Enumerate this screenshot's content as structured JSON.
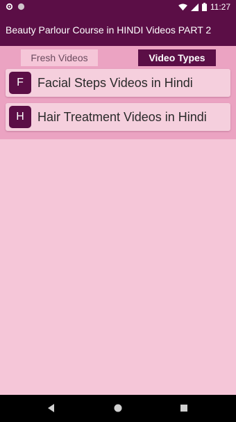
{
  "status_bar": {
    "time": "11:27",
    "icons": [
      "gear-icon",
      "circle-icon",
      "wifi-icon",
      "signal-icon",
      "battery-icon"
    ]
  },
  "app_bar": {
    "title": "Beauty Parlour Course in HINDI Videos PART 2"
  },
  "tabs": [
    {
      "label": "Fresh Videos",
      "selected": false
    },
    {
      "label": "Video Types",
      "selected": true
    }
  ],
  "video_types": [
    {
      "letter": "F",
      "label": "Facial Steps Videos in Hindi"
    },
    {
      "letter": "H",
      "label": "Hair Treatment Videos in Hindi"
    }
  ],
  "nav_bar": {
    "buttons": [
      "back-icon",
      "home-icon",
      "recents-icon"
    ]
  },
  "colors": {
    "primary": "#5b0e46",
    "background": "#f5c6d8",
    "tab_strip": "#eba3c2",
    "card": "#f5cfdd"
  }
}
